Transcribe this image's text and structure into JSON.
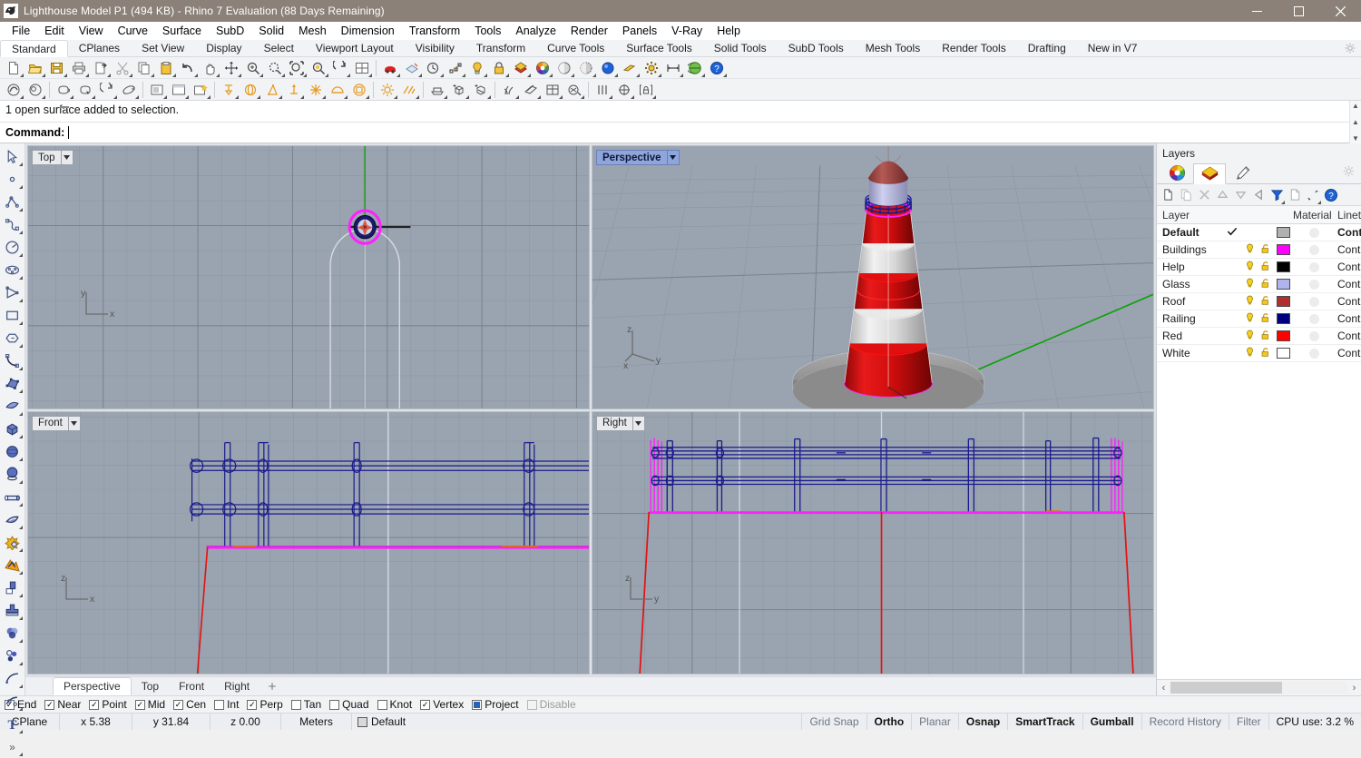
{
  "window": {
    "title": "Lighthouse Model P1 (494 KB) - Rhino 7 Evaluation (88 Days Remaining)",
    "icon": "rhino-logo-icon",
    "minimize": "─",
    "maximize": "☐",
    "close": "✕"
  },
  "menubar": {
    "items": [
      "File",
      "Edit",
      "View",
      "Curve",
      "Surface",
      "SubD",
      "Solid",
      "Mesh",
      "Dimension",
      "Transform",
      "Tools",
      "Analyze",
      "Render",
      "Panels",
      "V-Ray",
      "Help"
    ]
  },
  "toolbar_tabs": {
    "items": [
      "Standard",
      "CPlanes",
      "Set View",
      "Display",
      "Select",
      "Viewport Layout",
      "Visibility",
      "Transform",
      "Curve Tools",
      "Surface Tools",
      "Solid Tools",
      "SubD Tools",
      "Mesh Tools",
      "Render Tools",
      "Drafting",
      "New in V7"
    ],
    "active": "Standard",
    "options_icon": "gear-icon"
  },
  "toolbar_row1": [
    "new-file-icon",
    "open-folder-icon",
    "save-icon",
    "print-icon",
    "export-icon",
    "cut-scissors-icon",
    "copy-icon",
    "paste-icon",
    "undo-icon",
    "pan-hand-icon",
    "move-icon",
    "zoom-in-icon",
    "zoom-window-icon",
    "zoom-selected-icon",
    "zoom-extents-icon",
    "rotate-view-icon",
    "viewport-layout-icon",
    "car-icon",
    "plane-section-icon",
    "clock-history-icon",
    "point-edit-icon",
    "light-bulb-icon",
    "lock-icon",
    "layer-colors-icon",
    "color-wheel-icon",
    "shade-sphere-icon",
    "render-preview-icon",
    "render-icon",
    "clipping-plane-icon",
    "options-gear-icon",
    "dimension-icon",
    "vray-globe-icon",
    "help-icon"
  ],
  "toolbar_row2": [
    "shaded-view-icon",
    "rendered-view-icon",
    "teapot-icon",
    "teapot-select-icon",
    "rotate-object-icon",
    "orbit-icon",
    "panel-icon",
    "window-icon",
    "new-panel-icon",
    "surface-from-planar-icon",
    "revolve-icon",
    "cone-icon",
    "extrude-icon",
    "explode-icon",
    "cap-icon",
    "box-icon",
    "sun-icon",
    "linetype-icon",
    "grid-icon",
    "block-insert-icon",
    "block-edit-icon",
    "grass-icon",
    "material-icon",
    "table-icon",
    "paint-bucket-icon",
    "analysis-icon",
    "centroid-icon",
    "lock-bracket-icon"
  ],
  "command": {
    "history": "1 open surface added to selection.",
    "label": "Command:",
    "value": ""
  },
  "left_toolbar": [
    "select-arrow-icon",
    "point-icon",
    "polyline-icon",
    "curve-interp-icon",
    "arc-icon",
    "ellipse-icon",
    "polygon-icon",
    "rectangle-icon",
    "hexagon-icon",
    "curve-blend-icon",
    "control-points-icon",
    "surface-icon",
    "box-solid-icon",
    "sphere-icon",
    "cylinder-icon",
    "pipe-icon",
    "surface-edit-icon",
    "boolean-union-icon",
    "explode-curve-icon",
    "fillet-icon",
    "offset-icon",
    "mesh-boolean-icon",
    "circle-points-icon",
    "curve-from-object-icon",
    "curve-tools-icon",
    "text-icon",
    "more-tools-icon"
  ],
  "viewports": [
    {
      "name": "Top",
      "label": "Top",
      "active": false,
      "axes": [
        "y",
        "x"
      ]
    },
    {
      "name": "Perspective",
      "label": "Perspective",
      "active": true,
      "axes": [
        "z",
        "y",
        "x"
      ]
    },
    {
      "name": "Front",
      "label": "Front",
      "active": false,
      "axes": [
        "z",
        "x"
      ]
    },
    {
      "name": "Right",
      "label": "Right",
      "active": false,
      "axes": [
        "z",
        "y"
      ]
    }
  ],
  "viewport_tabs": {
    "items": [
      "Perspective",
      "Top",
      "Front",
      "Right"
    ],
    "active": "Perspective",
    "add_icon": "add-viewport-icon"
  },
  "layers_panel": {
    "title": "Layers",
    "tabs": [
      {
        "name": "properties-tab",
        "icon": "color-wheel-icon",
        "active": false
      },
      {
        "name": "layers-tab",
        "icon": "layers-stack-icon",
        "active": true
      },
      {
        "name": "display-tab",
        "icon": "paintbrush-icon",
        "active": false
      }
    ],
    "gear_icon": "panel-options-gear-icon",
    "toolbar": [
      "new-layer-icon",
      "duplicate-layer-icon",
      "delete-layer-icon",
      "move-up-icon",
      "move-down-icon",
      "move-left-icon",
      "filter-icon",
      "layer-sheet-icon",
      "layer-tools-icon",
      "help-icon"
    ],
    "columns": [
      "Layer",
      "",
      "",
      "",
      "",
      "Material",
      "Linet"
    ],
    "rows": [
      {
        "name": "Default",
        "current": true,
        "on": false,
        "lock": false,
        "color": "#b0b0b0",
        "linetype": "Cont",
        "bold": true
      },
      {
        "name": "Buildings",
        "current": false,
        "on": true,
        "lock": true,
        "color": "#ff00ff",
        "linetype": "Conti",
        "bold": false
      },
      {
        "name": "Help",
        "current": false,
        "on": true,
        "lock": true,
        "color": "#000000",
        "linetype": "Conti",
        "bold": false
      },
      {
        "name": "Glass",
        "current": false,
        "on": true,
        "lock": true,
        "color": "#b0b4ec",
        "linetype": "Conti",
        "bold": false
      },
      {
        "name": "Roof",
        "current": false,
        "on": true,
        "lock": true,
        "color": "#b03030",
        "linetype": "Conti",
        "bold": false
      },
      {
        "name": "Railing",
        "current": false,
        "on": true,
        "lock": true,
        "color": "#00007f",
        "linetype": "Conti",
        "bold": false
      },
      {
        "name": "Red",
        "current": false,
        "on": true,
        "lock": true,
        "color": "#ff0000",
        "linetype": "Conti",
        "bold": false
      },
      {
        "name": "White",
        "current": false,
        "on": true,
        "lock": true,
        "color": "#ffffff",
        "linetype": "Conti",
        "bold": false
      }
    ],
    "hscroll": {
      "left_arrow": "‹",
      "right_arrow": "›"
    }
  },
  "osnap": {
    "items": [
      {
        "label": "End",
        "checked": true,
        "type": "check"
      },
      {
        "label": "Near",
        "checked": true,
        "type": "check"
      },
      {
        "label": "Point",
        "checked": true,
        "type": "check"
      },
      {
        "label": "Mid",
        "checked": true,
        "type": "check"
      },
      {
        "label": "Cen",
        "checked": true,
        "type": "check"
      },
      {
        "label": "Int",
        "checked": false,
        "type": "check"
      },
      {
        "label": "Perp",
        "checked": true,
        "type": "check"
      },
      {
        "label": "Tan",
        "checked": false,
        "type": "check"
      },
      {
        "label": "Quad",
        "checked": false,
        "type": "check"
      },
      {
        "label": "Knot",
        "checked": false,
        "type": "check"
      },
      {
        "label": "Vertex",
        "checked": true,
        "type": "check"
      },
      {
        "label": "Project",
        "checked": true,
        "type": "filled"
      },
      {
        "label": "Disable",
        "checked": false,
        "type": "disabled"
      }
    ]
  },
  "statusbar": {
    "cplane": "CPlane",
    "x": "x 5.38",
    "y": "y 31.84",
    "z": "z 0.00",
    "units": "Meters",
    "layer": "Default",
    "layer_swatch": "#d8d8d8",
    "toggles": [
      {
        "label": "Grid Snap",
        "on": false
      },
      {
        "label": "Ortho",
        "on": true
      },
      {
        "label": "Planar",
        "on": false
      },
      {
        "label": "Osnap",
        "on": true
      },
      {
        "label": "SmartTrack",
        "on": true
      },
      {
        "label": "Gumball",
        "on": true
      },
      {
        "label": "Record History",
        "on": false
      },
      {
        "label": "Filter",
        "on": false
      }
    ],
    "cpu": "CPU use: 3.2 %"
  },
  "colors": {
    "titlebar": "#8b8178",
    "viewport_bg": "#9aa4b0",
    "accent_blue": "#8fa6db",
    "railing_navy": "#00007f",
    "magenta": "#ff00ff",
    "red": "#e01010",
    "selection_yellow": "#ffff00"
  }
}
